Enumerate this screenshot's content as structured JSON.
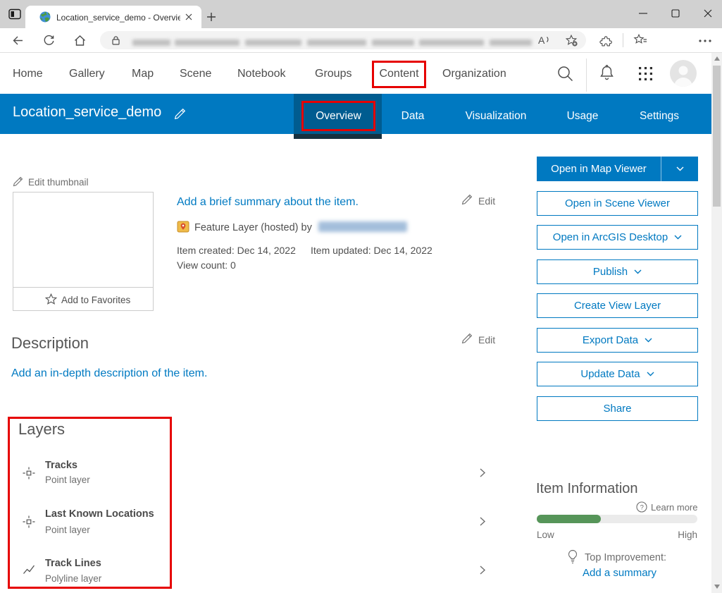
{
  "browser": {
    "tab": {
      "title": "Location_service_demo - Overvie"
    }
  },
  "nav": {
    "items": [
      {
        "label": "Home"
      },
      {
        "label": "Gallery"
      },
      {
        "label": "Map"
      },
      {
        "label": "Scene"
      },
      {
        "label": "Notebook"
      },
      {
        "label": "Groups"
      },
      {
        "label": "Content",
        "highlighted": true
      },
      {
        "label": "Organization"
      }
    ]
  },
  "item_header": {
    "title": "Location_service_demo",
    "tabs": [
      {
        "label": "Overview",
        "active": true,
        "highlighted": true
      },
      {
        "label": "Data"
      },
      {
        "label": "Visualization"
      },
      {
        "label": "Usage"
      },
      {
        "label": "Settings"
      }
    ]
  },
  "overview": {
    "edit_thumbnail_label": "Edit thumbnail",
    "add_to_favorites_label": "Add to Favorites",
    "summary_link": "Add a brief summary about the item.",
    "type_line_prefix": "Feature Layer (hosted) by",
    "created_label": "Item created: Dec 14, 2022",
    "updated_label": "Item updated: Dec 14, 2022",
    "view_count_label": "View count: 0",
    "edit_label": "Edit"
  },
  "description": {
    "heading": "Description",
    "edit_label": "Edit",
    "placeholder_link": "Add an in-depth description of the item."
  },
  "layers": {
    "heading": "Layers",
    "items": [
      {
        "title": "Tracks",
        "subtitle": "Point layer",
        "icon": "point-layer-icon"
      },
      {
        "title": "Last Known Locations",
        "subtitle": "Point layer",
        "icon": "point-layer-icon"
      },
      {
        "title": "Track Lines",
        "subtitle": "Polyline layer",
        "icon": "polyline-layer-icon"
      }
    ]
  },
  "actions": {
    "buttons": [
      {
        "label": "Open in Map Viewer",
        "style": "filled",
        "split_dropdown": true
      },
      {
        "label": "Open in Scene Viewer",
        "style": "outlined"
      },
      {
        "label": "Open in ArcGIS Desktop",
        "style": "outlined",
        "dropdown": true
      },
      {
        "label": "Publish",
        "style": "outlined",
        "dropdown": true
      },
      {
        "label": "Create View Layer",
        "style": "outlined"
      },
      {
        "label": "Export Data",
        "style": "outlined",
        "dropdown": true
      },
      {
        "label": "Update Data",
        "style": "outlined",
        "dropdown": true
      },
      {
        "label": "Share",
        "style": "outlined"
      }
    ]
  },
  "item_information": {
    "heading": "Item Information",
    "learn_more_label": "Learn more",
    "low_label": "Low",
    "high_label": "High",
    "progress_percent": 40,
    "progress_color": "#569559",
    "top_improvement_label": "Top Improvement:",
    "suggestion_link": "Add a summary"
  },
  "colors": {
    "brand_blue": "#0079c1",
    "active_tab_blue": "#005c90",
    "highlight_red": "#e60000"
  }
}
